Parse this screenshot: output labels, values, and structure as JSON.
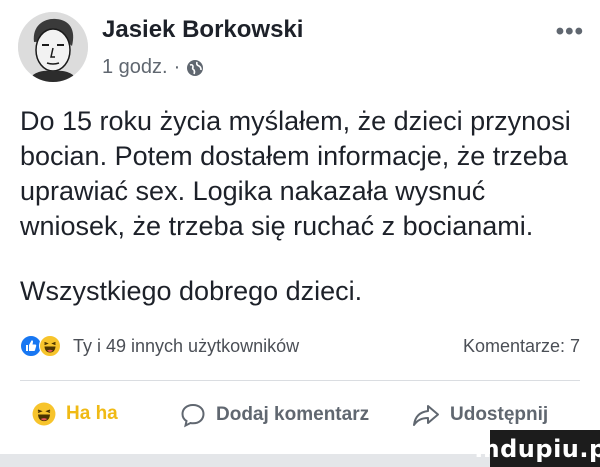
{
  "post": {
    "author": "Jasiek Borkowski",
    "time": "1 godz.",
    "separator": "·",
    "more_label": "•••",
    "icons": {
      "avatar": "profile-photo",
      "privacy": "globe-icon",
      "more": "more-options-icon"
    },
    "text_paragraph_1": "Do 15 roku życia myślałem, że dzieci przynosi bocian. Potem dostałem informacje, że trzeba uprawiać sex. Logika nakazała wysnuć wniosek, że trzeba się ruchać z bocianami.",
    "text_paragraph_2": "Wszystkiego dobrego dzieci."
  },
  "reactions": {
    "types": [
      "like",
      "haha"
    ],
    "summary": "Ty i 49 innych użytkowników",
    "comments": "Komentarze: 7"
  },
  "actions": {
    "haha_label": "Ha ha",
    "comment_label": "Dodaj komentarz",
    "share_label": "Udostępnij"
  },
  "colors": {
    "like_blue": "#1877f2",
    "haha_yellow": "#f7c42c",
    "text": "#1d2129",
    "secondary_text": "#606770"
  },
  "watermark": {
    "text": "mdupiu.pl"
  }
}
